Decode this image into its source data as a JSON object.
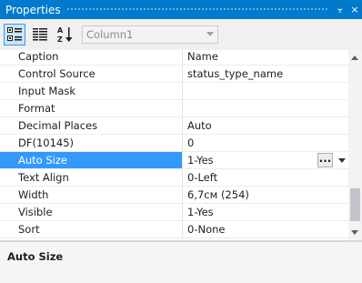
{
  "window": {
    "title": "Properties",
    "pin_glyph": "⫟",
    "close_glyph": "×"
  },
  "toolbar": {
    "categorized_icon": "categorized-icon",
    "property_pages_icon": "property-pages-icon",
    "alphabetical_icon": "alphabetical-sort-icon",
    "object_selector_value": "Column1"
  },
  "properties": [
    {
      "name": "Caption",
      "value": "Name"
    },
    {
      "name": "Control Source",
      "value": "status_type_name"
    },
    {
      "name": "Input Mask",
      "value": ""
    },
    {
      "name": "Format",
      "value": ""
    },
    {
      "name": "Decimal Places",
      "value": "Auto"
    },
    {
      "name": "DF(10145)",
      "value": "0"
    },
    {
      "name": "Auto Size",
      "value": "1-Yes",
      "selected": true,
      "ellipsis": "..."
    },
    {
      "name": "Text Align",
      "value": "0-Left"
    },
    {
      "name": "Width",
      "value": "6,7см (254)"
    },
    {
      "name": "Visible",
      "value": "1-Yes"
    },
    {
      "name": "Sort",
      "value": "0-None"
    }
  ],
  "description": {
    "title": "Auto Size"
  },
  "colors": {
    "titlebar": "#007acc",
    "selection": "#3399ff"
  }
}
